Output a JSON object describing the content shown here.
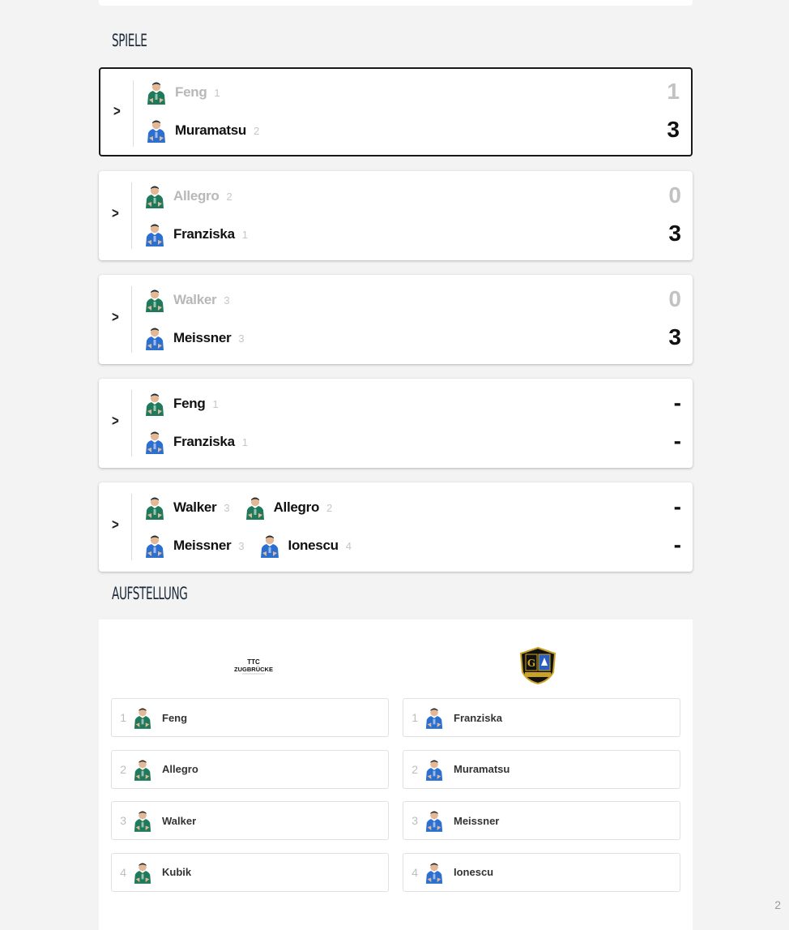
{
  "sections": {
    "matches_title": "SPIELE",
    "lineup_title": "AUFSTELLUNG"
  },
  "colors": {
    "home_jersey": "#1f7a5c",
    "away_jersey": "#2b6fd0",
    "muted_text": "#b8b8b8",
    "active_border": "#1a1a1a"
  },
  "matches": [
    {
      "home": [
        {
          "name": "Feng",
          "seed": "1"
        }
      ],
      "away": [
        {
          "name": "Muramatsu",
          "seed": "2"
        }
      ],
      "home_score": "1",
      "away_score": "3",
      "home_muted": true,
      "active": true
    },
    {
      "home": [
        {
          "name": "Allegro",
          "seed": "2"
        }
      ],
      "away": [
        {
          "name": "Franziska",
          "seed": "1"
        }
      ],
      "home_score": "0",
      "away_score": "3",
      "home_muted": true,
      "active": false
    },
    {
      "home": [
        {
          "name": "Walker",
          "seed": "3"
        }
      ],
      "away": [
        {
          "name": "Meissner",
          "seed": "3"
        }
      ],
      "home_score": "0",
      "away_score": "3",
      "home_muted": true,
      "active": false
    },
    {
      "home": [
        {
          "name": "Feng",
          "seed": "1"
        }
      ],
      "away": [
        {
          "name": "Franziska",
          "seed": "1"
        }
      ],
      "home_score": "-",
      "away_score": "-",
      "home_muted": false,
      "active": false
    },
    {
      "home": [
        {
          "name": "Walker",
          "seed": "3"
        },
        {
          "name": "Allegro",
          "seed": "2"
        }
      ],
      "away": [
        {
          "name": "Meissner",
          "seed": "3"
        },
        {
          "name": "Ionescu",
          "seed": "4"
        }
      ],
      "home_score": "-",
      "away_score": "-",
      "home_muted": false,
      "active": false
    }
  ],
  "lineup": {
    "home_logo_icon": "ttc-zugbruecke-logo",
    "away_logo_icon": "saarbruecken-club-crest",
    "home": [
      {
        "num": "1",
        "name": "Feng"
      },
      {
        "num": "2",
        "name": "Allegro"
      },
      {
        "num": "3",
        "name": "Walker"
      },
      {
        "num": "4",
        "name": "Kubik"
      }
    ],
    "away": [
      {
        "num": "1",
        "name": "Franziska"
      },
      {
        "num": "2",
        "name": "Muramatsu"
      },
      {
        "num": "3",
        "name": "Meissner"
      },
      {
        "num": "4",
        "name": "Ionescu"
      }
    ]
  },
  "icons": {
    "expand": "chevron-right-icon",
    "player": "player-avatar-icon"
  },
  "corner_mark": "2"
}
